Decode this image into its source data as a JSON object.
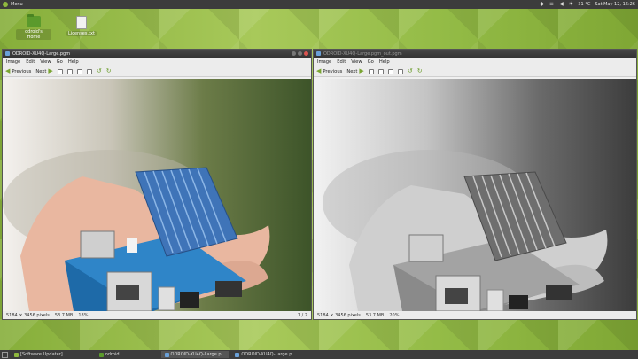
{
  "top_panel": {
    "menu_label": "Menu",
    "weather": "31 °C",
    "clock": "Sat May 12, 16:26"
  },
  "desktop_icons": [
    {
      "label": "odroid's Home",
      "icon": "folder-icon"
    },
    {
      "label": "Licenses.txt",
      "icon": "text-file-icon"
    }
  ],
  "left_window": {
    "title": "ODROID-XU4Q-Large.pgm",
    "menu": [
      "Image",
      "Edit",
      "View",
      "Go",
      "Help"
    ],
    "toolbar": {
      "prev": "Previous",
      "next": "Next"
    },
    "status": {
      "dimensions": "5184 × 3456 pixels",
      "size": "53.7 MB",
      "zoom": "18%",
      "page": "1 / 2"
    }
  },
  "right_window": {
    "title": "ODROID-XU4Q-Large.pgm_out.pgm",
    "menu": [
      "Image",
      "Edit",
      "View",
      "Go",
      "Help"
    ],
    "toolbar": {
      "prev": "Previous",
      "next": "Next"
    },
    "status": {
      "dimensions": "5184 × 3456 pixels",
      "size": "53.7 MB",
      "zoom": "20%"
    }
  },
  "taskbar": {
    "items": [
      {
        "label": "[Software Updater]",
        "icon": "updater-icon"
      },
      {
        "label": "odroid",
        "icon": "folder-icon"
      },
      {
        "label": "ODROID-XU4Q-Large.p...",
        "icon": "image-viewer-icon"
      },
      {
        "label": "ODROID-XU4Q-Large.p...",
        "icon": "image-viewer-icon"
      }
    ]
  },
  "colors": {
    "accent": "#8fb83e",
    "panel": "#3c3c3c",
    "close": "#d9534f"
  }
}
